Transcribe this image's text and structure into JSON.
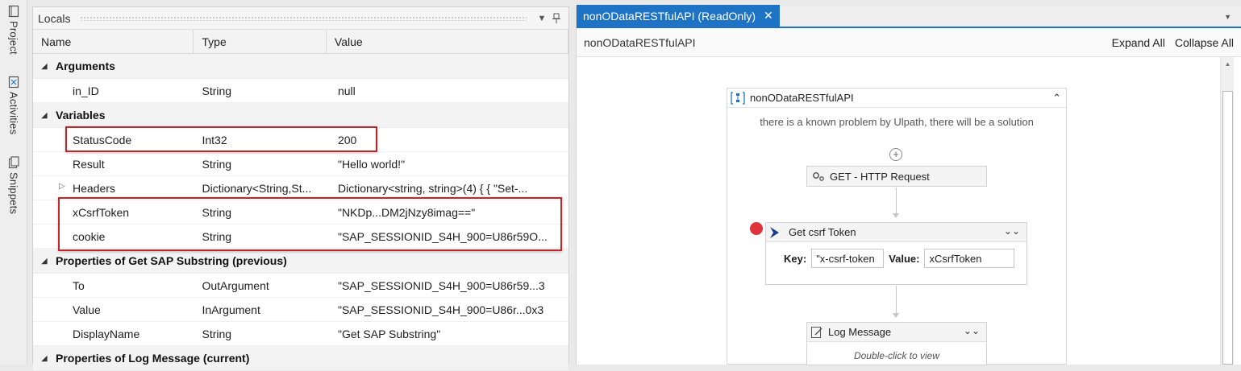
{
  "side_tabs": [
    {
      "label": "Project",
      "icon": "project-icon"
    },
    {
      "label": "Activities",
      "icon": "activities-icon"
    },
    {
      "label": "Snippets",
      "icon": "snippets-icon"
    }
  ],
  "locals": {
    "title": "Locals",
    "columns": {
      "name": "Name",
      "type": "Type",
      "value": "Value"
    },
    "groups": {
      "arguments": {
        "label": "Arguments",
        "rows": [
          {
            "name": "in_ID",
            "type": "String",
            "value": "null"
          }
        ]
      },
      "variables": {
        "label": "Variables",
        "rows": [
          {
            "name": "StatusCode",
            "type": "Int32",
            "value": "200"
          },
          {
            "name": "Result",
            "type": "String",
            "value": "\"Hello world!\""
          },
          {
            "name": "Headers",
            "type": "Dictionary<String,St...",
            "value": "Dictionary<string, string>(4) { { \"Set-..."
          },
          {
            "name": "xCsrfToken",
            "type": "String",
            "value": "\"NKDp...DM2jNzy8imag==\""
          },
          {
            "name": "cookie",
            "type": "String",
            "value": "\"SAP_SESSIONID_S4H_900=U86r59O..."
          }
        ]
      },
      "previous": {
        "label": "Properties of Get SAP Substring (previous)",
        "rows": [
          {
            "name": "To",
            "type": "OutArgument",
            "value": "\"SAP_SESSIONID_S4H_900=U86r59...3"
          },
          {
            "name": "Value",
            "type": "InArgument",
            "value": "\"SAP_SESSIONID_S4H_900=U86r...0x3"
          },
          {
            "name": "DisplayName",
            "type": "String",
            "value": "\"Get SAP Substring\""
          }
        ]
      },
      "current": {
        "label": "Properties of Log Message (current)"
      }
    }
  },
  "designer": {
    "tab_label": "nonODataRESTfulAPI (ReadOnly)",
    "breadcrumb": "nonODataRESTfulAPI",
    "expand_all": "Expand All",
    "collapse_all": "Collapse All",
    "sequence": {
      "title": "nonODataRESTfulAPI",
      "annotation": "there is a known problem by Ulpath, there will be a solution"
    },
    "activities": {
      "http": {
        "title": "GET - HTTP Request"
      },
      "csrf": {
        "title": "Get csrf Token",
        "key_label": "Key:",
        "key_value": "\"x-csrf-token",
        "value_label": "Value:",
        "value_value": "xCsrfToken"
      },
      "log": {
        "title": "Log Message",
        "hint": "Double-click to view"
      }
    }
  },
  "colors": {
    "accent": "#1f73c5",
    "highlight_border": "#c0272d",
    "breakpoint": "#e0343c"
  }
}
